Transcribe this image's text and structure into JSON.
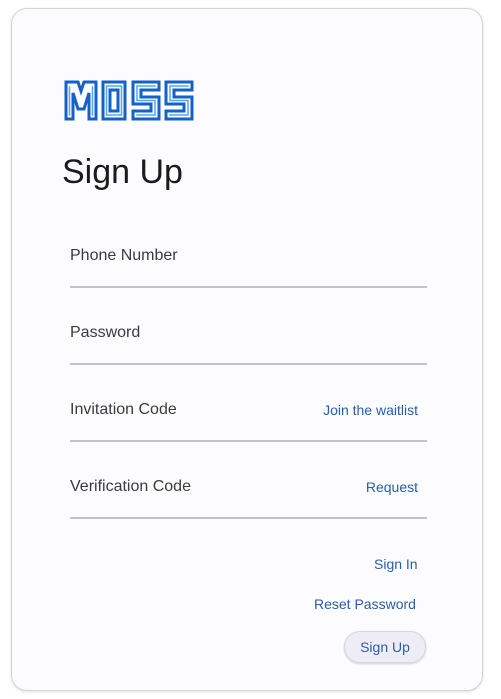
{
  "brand": {
    "logo_text": "MOSS",
    "primary_color": "#1461c7",
    "secondary_color": "#57a9e8"
  },
  "page": {
    "title": "Sign Up"
  },
  "form": {
    "phone": {
      "placeholder": "Phone Number",
      "value": ""
    },
    "password": {
      "placeholder": "Password",
      "value": ""
    },
    "invitation": {
      "placeholder": "Invitation Code",
      "value": "",
      "action_label": "Join the waitlist"
    },
    "verification": {
      "placeholder": "Verification Code",
      "value": "",
      "action_label": "Request"
    }
  },
  "links": {
    "sign_in": "Sign In",
    "reset_password": "Reset Password"
  },
  "actions": {
    "submit_label": "Sign Up"
  },
  "colors": {
    "accent": "#2a5ea8",
    "card_background": "#fcfbfe",
    "underline": "#c3c2c8"
  }
}
